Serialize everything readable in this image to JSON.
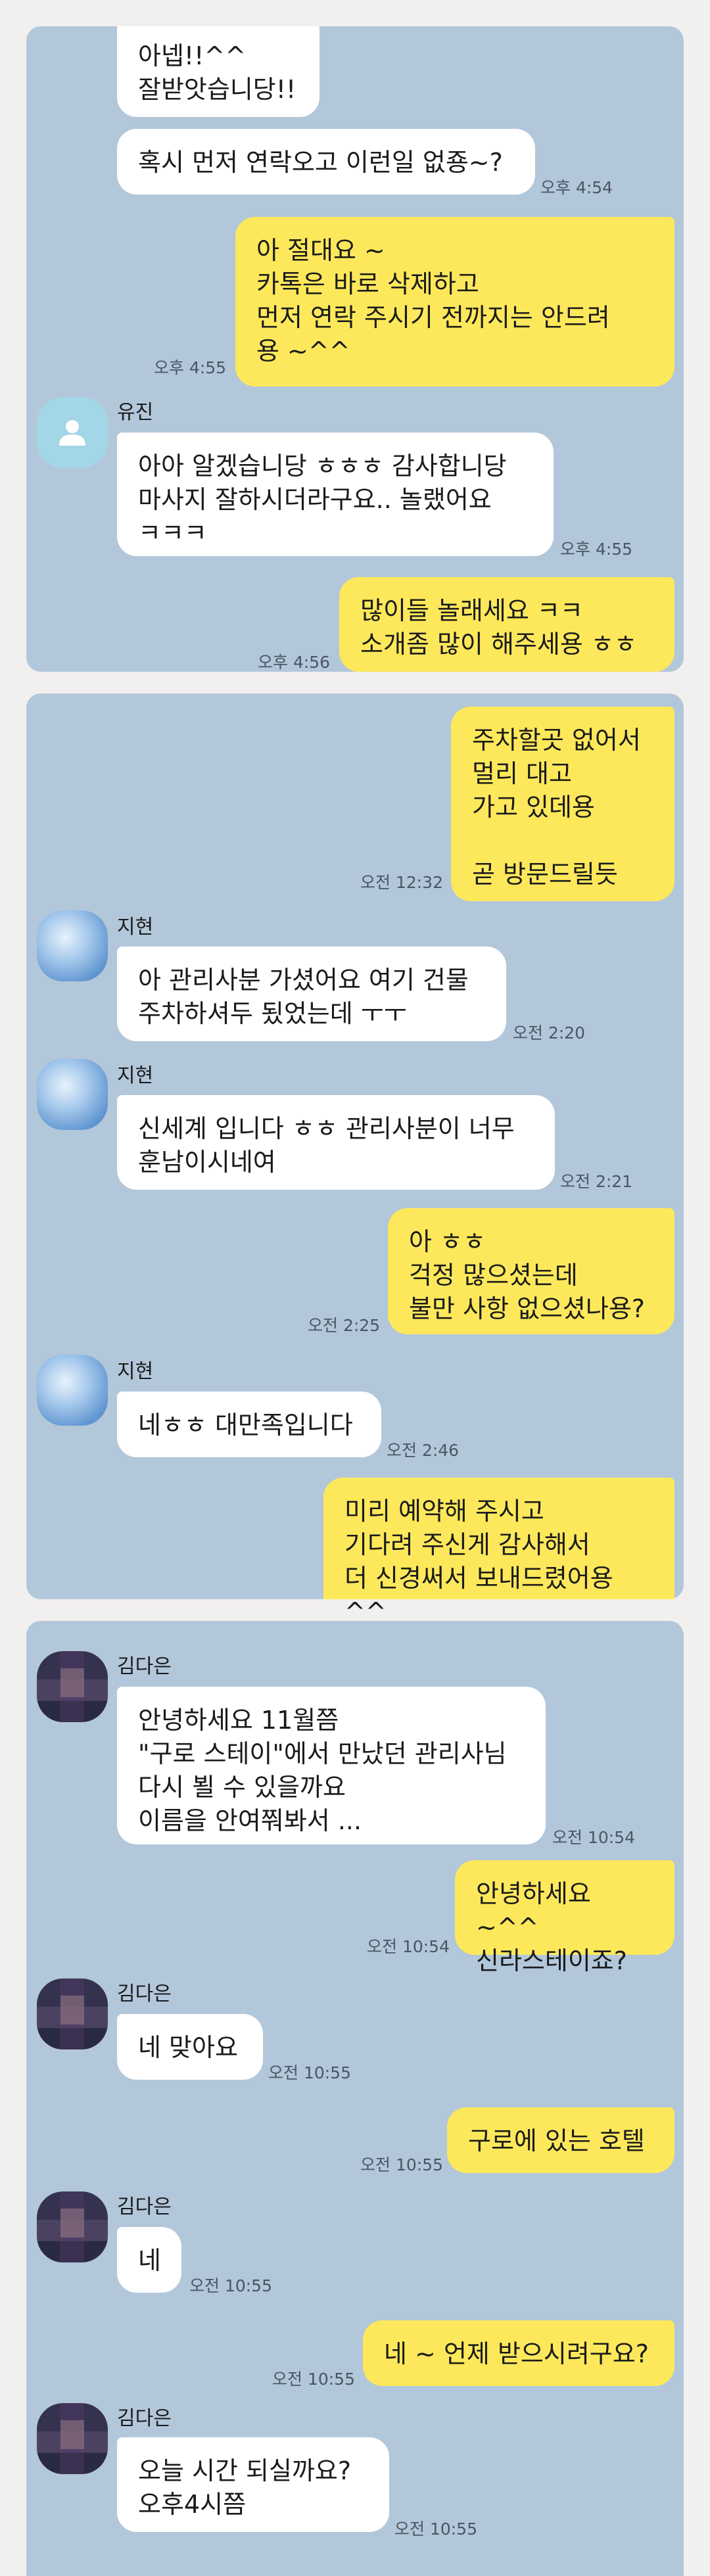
{
  "panels": [
    {
      "messages": [
        {
          "text": "아넵!!^^\n잘받앗습니당!!"
        },
        {
          "text": "혹시 먼저 연락오고 이런일 없죵~?",
          "time": "오후 4:54"
        },
        {
          "text": "아 절대요 ~\n카톡은 바로 삭제하고\n먼저 연락 주시기 전까지는 안드려\n용 ~^^",
          "time": "오후 4:55"
        },
        {
          "sender": "유진",
          "text": "아아 알겠습니당 ㅎㅎㅎ 감사합니당\n마사지 잘하시더라구요.. 놀랬어요\nㅋㅋㅋ",
          "time": "오후 4:55"
        },
        {
          "text": "많이들 놀래세요 ㅋㅋ\n소개좀 많이 해주세용 ㅎㅎ",
          "time": "오후 4:56"
        }
      ]
    },
    {
      "messages": [
        {
          "text": "주차할곳 없어서\n멀리 대고\n가고 있데용\n\n곧 방문드릴듯",
          "time": "오전 12:32"
        },
        {
          "sender": "지현",
          "text": "아 관리사분 가셨어요 여기 건물\n주차하셔두 됬었는데 ㅜㅜ",
          "time": "오전 2:20"
        },
        {
          "sender": "지현",
          "text": "신세계 입니다 ㅎㅎ 관리사분이 너무\n훈남이시네여",
          "time": "오전 2:21"
        },
        {
          "text": "아 ㅎㅎ\n걱정 많으셨는데\n불만 사항 없으셨나용?",
          "time": "오전 2:25"
        },
        {
          "sender": "지현",
          "text": "네ㅎㅎ 대만족입니다",
          "time": "오전 2:46"
        },
        {
          "text": "미리 예약해 주시고\n기다려 주신게 감사해서\n더 신경써서 보내드렸어용 ^^"
        }
      ]
    },
    {
      "messages": [
        {
          "sender": "김다은",
          "text": "안녕하세요 11월쯤\n\"구로 스테이\"에서 만났던 관리사님\n다시 뵐 수 있을까요\n이름을 안여쭤봐서 ...",
          "time": "오전 10:54"
        },
        {
          "text": "안녕하세요 ~^^\n신라스테이죠?",
          "time": "오전 10:54"
        },
        {
          "sender": "김다은",
          "text": "네 맞아요",
          "time": "오전 10:55"
        },
        {
          "text": "구로에 있는 호텔",
          "time": "오전 10:55"
        },
        {
          "sender": "김다은",
          "text": "네",
          "time": "오전 10:55"
        },
        {
          "text": "네 ~ 언제 받으시려구요?",
          "time": "오전 10:55"
        },
        {
          "sender": "김다은",
          "text": "오늘  시간 되실까요?\n오후4시쯤",
          "time": "오전 10:55"
        }
      ]
    }
  ],
  "colors": {
    "panel_bg": "#b2c7da",
    "outgoing_bubble": "#fde85b",
    "incoming_bubble": "#ffffff",
    "page_bg": "#f2f0ef"
  },
  "avatars": {
    "유진": "default-person-icon",
    "지현": "blurred-profile-photo",
    "김다은": "pixelated-profile-photo"
  }
}
